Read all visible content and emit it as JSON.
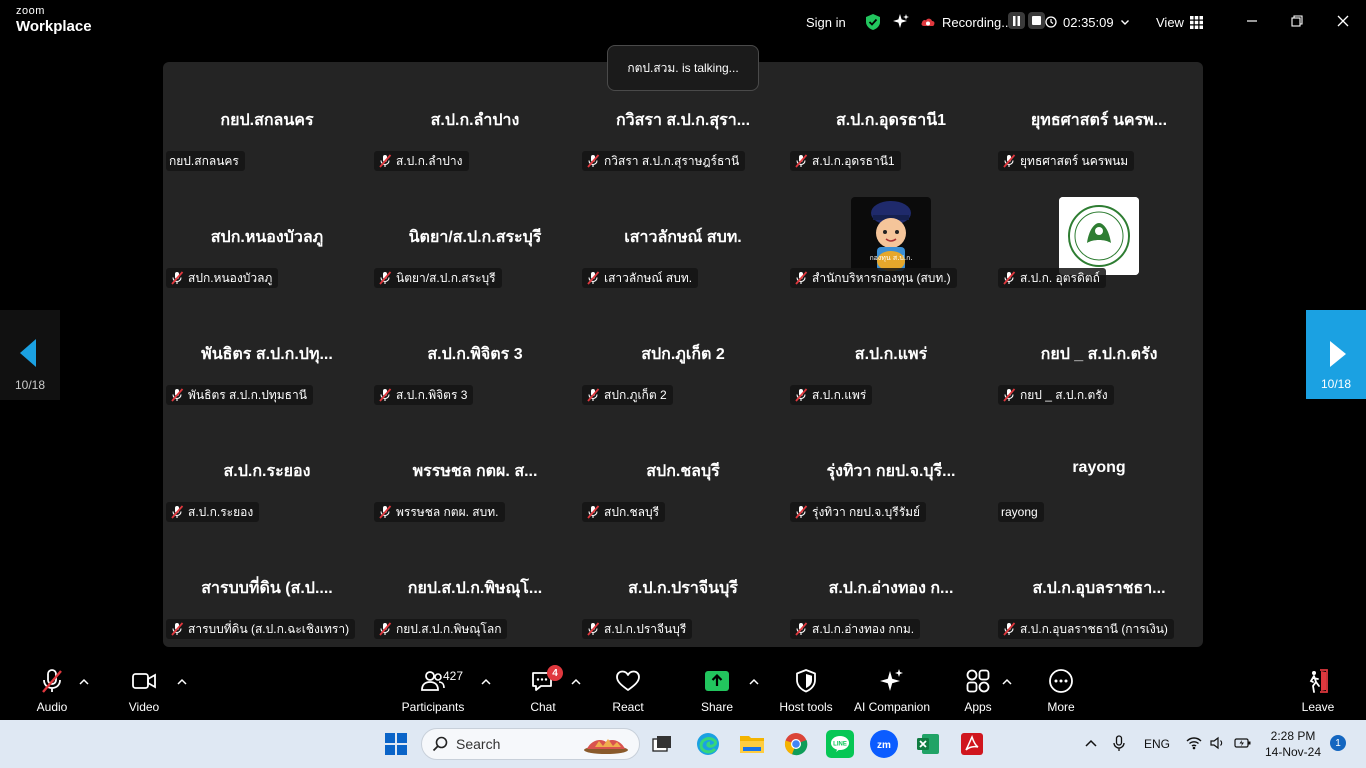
{
  "app": {
    "brand_top": "zoom",
    "brand_bottom": "Workplace"
  },
  "titlebar": {
    "sign_in": "Sign in",
    "recording_label": "Recording...",
    "timer": "02:35:09",
    "view_label": "View"
  },
  "talking": "กตป.สวม. is talking...",
  "gallery": {
    "tiles": [
      {
        "big": "กยป.สกลนคร",
        "tag": "กยป.สกลนคร",
        "muted": false
      },
      {
        "big": "ส.ป.ก.ลำปาง",
        "tag": "ส.ป.ก.ลำปาง",
        "muted": true
      },
      {
        "big": "กวิสรา ส.ป.ก.สุรา...",
        "tag": "กวิสรา ส.ป.ก.สุราษฎร์ธานี",
        "muted": true
      },
      {
        "big": "ส.ป.ก.อุดรธานี1",
        "tag": "ส.ป.ก.อุดรธานี1",
        "muted": true
      },
      {
        "big": "ยุทธศาสตร์ นครพ...",
        "tag": "ยุทธศาสตร์ นครพนม",
        "muted": true
      },
      {
        "big": "สปก.หนองบัวลภู",
        "tag": "สปก.หนองบัวลภู",
        "muted": true
      },
      {
        "big": "นิตยา/ส.ป.ก.สระบุรี",
        "tag": "นิตยา/ส.ป.ก.สระบุรี",
        "muted": true
      },
      {
        "big": "เสาวลักษณ์ สบท.",
        "tag": "เสาวลักษณ์ สบท.",
        "muted": true
      },
      {
        "big": "",
        "tag": "สำนักบริหารกองทุน (สบท.)",
        "muted": true,
        "avatar": "fund"
      },
      {
        "big": "",
        "tag": "ส.ป.ก. อุตรดิตถ์",
        "muted": true,
        "avatar": "seal"
      },
      {
        "big": "พันธิตร ส.ป.ก.ปทุ...",
        "tag": "พันธิตร ส.ป.ก.ปทุมธานี",
        "muted": true
      },
      {
        "big": "ส.ป.ก.พิจิตร 3",
        "tag": "ส.ป.ก.พิจิตร 3",
        "muted": true
      },
      {
        "big": "สปก.ภูเก็ต 2",
        "tag": "สปก.ภูเก็ต 2",
        "muted": true
      },
      {
        "big": "ส.ป.ก.แพร่",
        "tag": "ส.ป.ก.แพร่",
        "muted": true
      },
      {
        "big": "กยป _ ส.ป.ก.ตรัง",
        "tag": "กยป _ ส.ป.ก.ตรัง",
        "muted": true
      },
      {
        "big": "ส.ป.ก.ระยอง",
        "tag": "ส.ป.ก.ระยอง",
        "muted": true
      },
      {
        "big": "พรรษชล กตผ. ส...",
        "tag": "พรรษชล กตผ. สบท.",
        "muted": true
      },
      {
        "big": "สปก.ชลบุรี",
        "tag": "สปก.ชลบุรี",
        "muted": true
      },
      {
        "big": "รุ่งทิวา กยป.จ.บุรี...",
        "tag": "รุ่งทิวา กยป.จ.บุรีรัมย์",
        "muted": true
      },
      {
        "big": "rayong",
        "tag": "rayong",
        "muted": false
      },
      {
        "big": "สารบบที่ดิน (ส.ป....",
        "tag": "สารบบที่ดิน (ส.ป.ก.ฉะเชิงเทรา)",
        "muted": true
      },
      {
        "big": "กยป.ส.ป.ก.พิษณุโ...",
        "tag": "กยป.ส.ป.ก.พิษณุโลก",
        "muted": true
      },
      {
        "big": "ส.ป.ก.ปราจีนบุรี",
        "tag": "ส.ป.ก.ปราจีนบุรี",
        "muted": true
      },
      {
        "big": "ส.ป.ก.อ่างทอง  ก...",
        "tag": "ส.ป.ก.อ่างทอง  กกม.",
        "muted": true
      },
      {
        "big": "ส.ป.ก.อุบลราชธา...",
        "tag": "ส.ป.ก.อุบลราชธานี (การเงิน)",
        "muted": true
      }
    ],
    "fund_avatar_text": "กองทุน ส.ป.ก."
  },
  "nav": {
    "left_count": "10/18",
    "right_count": "10/18"
  },
  "toolbar": {
    "audio": "Audio",
    "video": "Video",
    "participants": "Participants",
    "participants_count": "427",
    "chat": "Chat",
    "chat_badge": "4",
    "react": "React",
    "share": "Share",
    "host_tools": "Host tools",
    "ai_companion": "AI Companion",
    "apps": "Apps",
    "more": "More",
    "leave": "Leave"
  },
  "taskbar": {
    "search_placeholder": "Search",
    "lang": "ENG",
    "time": "2:28 PM",
    "date": "14-Nov-24",
    "notifications": "1"
  },
  "colors": {
    "accent": "#1ba1e2",
    "mute_red": "#e0383e",
    "share_green": "#22c55e"
  }
}
